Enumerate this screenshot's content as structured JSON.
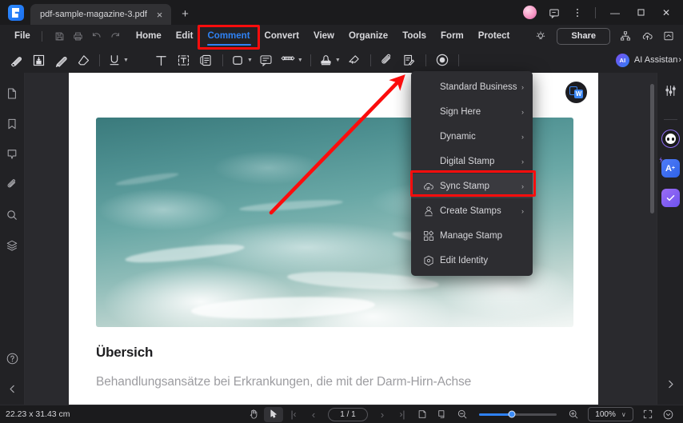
{
  "window": {
    "tab_title": "pdf-sample-magazine-3.pdf",
    "close_tab_glyph": "×",
    "new_tab_glyph": "+",
    "minimize_glyph": "—",
    "maximize_glyph": "□",
    "close_glyph": "✕"
  },
  "menubar": {
    "items": [
      {
        "label": "File",
        "active": false
      },
      {
        "label": "Home",
        "active": false
      },
      {
        "label": "Edit",
        "active": false
      },
      {
        "label": "Comment",
        "active": true
      },
      {
        "label": "Convert",
        "active": false
      },
      {
        "label": "View",
        "active": false
      },
      {
        "label": "Organize",
        "active": false
      },
      {
        "label": "Tools",
        "active": false
      },
      {
        "label": "Form",
        "active": false
      },
      {
        "label": "Protect",
        "active": false
      }
    ],
    "share_label": "Share"
  },
  "toolbar": {
    "ai_badge": "AI",
    "ai_label": "AI Assistan",
    "ai_arrow": "›"
  },
  "dropdown": {
    "items": [
      {
        "label": "Standard Business",
        "icon": "none",
        "arrow": "›",
        "highlighted": false
      },
      {
        "label": "Sign Here",
        "icon": "none",
        "arrow": "›",
        "highlighted": false
      },
      {
        "label": "Dynamic",
        "icon": "none",
        "arrow": "›",
        "highlighted": false
      },
      {
        "label": "Digital Stamp",
        "icon": "none",
        "arrow": "›",
        "highlighted": false
      },
      {
        "label": "Sync Stamp",
        "icon": "cloud-sync",
        "arrow": "›",
        "highlighted": true
      },
      {
        "label": "Create Stamps",
        "icon": "person-stamp",
        "arrow": "›",
        "highlighted": false
      },
      {
        "label": "Manage Stamp",
        "icon": "grid-shapes",
        "arrow": "",
        "highlighted": false
      },
      {
        "label": "Edit Identity",
        "icon": "hexagon-dot",
        "arrow": "",
        "highlighted": false
      }
    ]
  },
  "document": {
    "heading": "Übersich",
    "body": "Behandlungsansätze bei Erkrankungen, die mit der Darm-Hirn-Achse",
    "convert_badge_letter": "W"
  },
  "statusbar": {
    "dimensions": "22.23 x 31.43 cm",
    "page_indicator": "1 / 1",
    "zoom_level": "100%",
    "zoom_caret": "∨",
    "first_glyph": "|‹",
    "prev_glyph": "‹",
    "next_glyph": "›",
    "last_glyph": "›|"
  },
  "colors": {
    "accent": "#2f82f5",
    "annotation_red": "#fb0d0d",
    "menu_bg": "#2d2d31",
    "window_bg": "#222225",
    "photo_teal": "#4e9091"
  }
}
